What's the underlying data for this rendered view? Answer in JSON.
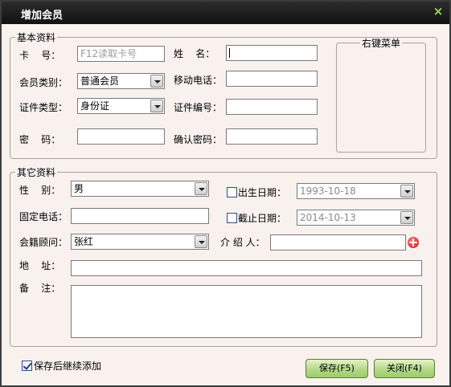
{
  "window": {
    "title": "增加会员",
    "close_glyph": "×"
  },
  "basic": {
    "legend": "基本资料",
    "card_label": "卡    号：",
    "card_placeholder": "F12读取卡号",
    "name_label": "姓    名：",
    "name_value": "",
    "member_type_label": "会员类别：",
    "member_type_value": "普通会员",
    "mobile_label": "移动电话：",
    "mobile_value": "",
    "id_type_label": "证件类型：",
    "id_type_value": "身份证",
    "id_number_label": "证件编号：",
    "id_number_value": "",
    "password_label": "密    码：",
    "password_value": "",
    "confirm_password_label": "确认密码：",
    "confirm_password_value": "",
    "context_menu_legend": "右键菜单"
  },
  "other": {
    "legend": "其它资料",
    "gender_label": "性    别：",
    "gender_value": "男",
    "birthday_label": "出生日期：",
    "birthday_value": "1993-10-18",
    "phone_label": "固定电话：",
    "phone_value": "",
    "expire_label": "截止日期：",
    "expire_value": "2014-10-13",
    "advisor_label": "会籍顾问：",
    "advisor_value": "张红",
    "referrer_label": "介 绍 人：",
    "referrer_value": "",
    "address_label": "地    址：",
    "address_value": "",
    "notes_label": "备    注：",
    "notes_value": ""
  },
  "footer": {
    "keep_adding_label": "保存后继续添加",
    "keep_adding_checked": true,
    "save_label": "保存(F5)",
    "close_label": "关闭(F4)"
  },
  "colors": {
    "titlebar": "#1a1a1a",
    "close_icon": "#9fd95b",
    "button": "#b4d88a",
    "background": "#f8f1ee"
  }
}
